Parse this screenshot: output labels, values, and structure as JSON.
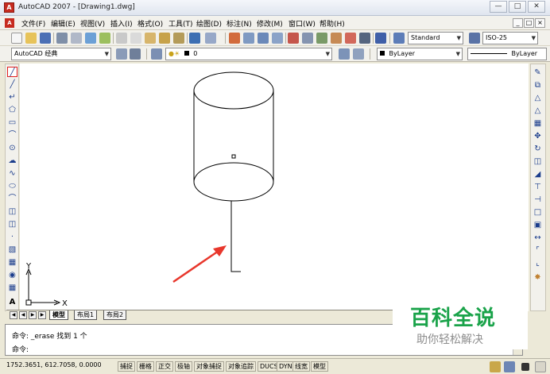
{
  "window": {
    "title": "AutoCAD 2007 - [Drawing1.dwg]",
    "app_icon": "autocad-logo-icon",
    "controls": [
      "—",
      "□",
      "✕"
    ]
  },
  "menubar": {
    "items": [
      "文件(F)",
      "编辑(E)",
      "视图(V)",
      "插入(I)",
      "格式(O)",
      "工具(T)",
      "绘图(D)",
      "标注(N)",
      "修改(M)",
      "窗口(W)",
      "帮助(H)"
    ],
    "mdi_controls": [
      "_",
      "□",
      "×"
    ]
  },
  "toolbar1": {
    "text_style": "Standard",
    "dim_style": "ISO-25"
  },
  "toolbar2": {
    "workspace": "AutoCAD 经典",
    "layer": "0",
    "color": "ByLayer",
    "linetype": "ByLayer"
  },
  "left_tools": [
    "line-icon",
    "construction-line-icon",
    "polyline-icon",
    "polygon-icon",
    "rectangle-icon",
    "arc-icon",
    "circle-icon",
    "revision-cloud-icon",
    "spline-icon",
    "ellipse-icon",
    "ellipse-arc-icon",
    "insert-block-icon",
    "make-block-icon",
    "point-icon",
    "hatch-icon",
    "gradient-icon",
    "region-icon",
    "table-icon",
    "multiline-text-icon"
  ],
  "right_tools": [
    "erase-icon",
    "copy-icon",
    "mirror-icon",
    "offset-icon",
    "array-icon",
    "move-icon",
    "rotate-icon",
    "scale-icon",
    "stretch-icon",
    "trim-icon",
    "extend-icon",
    "break-at-point-icon",
    "break-icon",
    "join-icon",
    "chamfer-icon",
    "fillet-icon",
    "explode-icon"
  ],
  "ucs": {
    "x_label": "X",
    "y_label": "Y"
  },
  "layout_tabs": [
    "模型",
    "布局1",
    "布局2"
  ],
  "command": {
    "history": "命令: _erase 找到 1 个",
    "prompt": "命令:"
  },
  "statusbar": {
    "coords": "1752.3651, 612.7058, 0.0000",
    "toggles": [
      "捕捉",
      "栅格",
      "正交",
      "极轴",
      "对象捕捉",
      "对象追踪",
      "DUCS",
      "DYN",
      "线宽",
      "模型"
    ]
  },
  "watermark": {
    "title": "百科全说",
    "subtitle": "助你轻松解决"
  },
  "colors": {
    "annotation_arrow": "#e8372c",
    "watermark_green": "#1aa34a",
    "active_tool_border": "#e21f1f"
  }
}
